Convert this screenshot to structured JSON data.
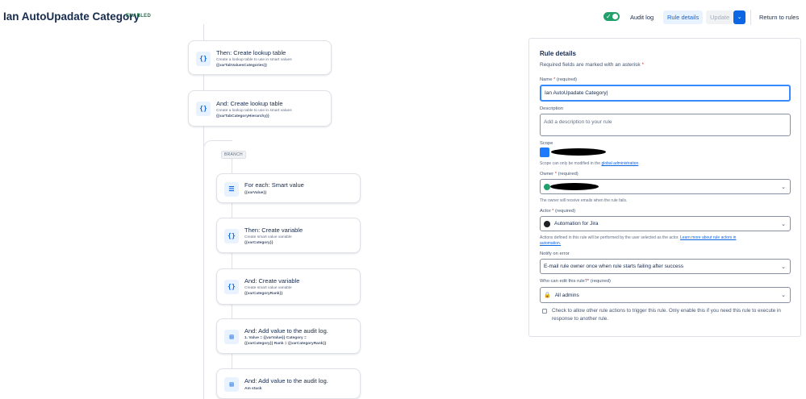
{
  "header": {
    "title": "Ian AutoUpadate Category",
    "status_badge": "ENABLED",
    "audit_log_label": "Audit log",
    "rule_details_label": "Rule details",
    "update_label": "Update",
    "return_label": "Return to rules",
    "toggle_on": true
  },
  "flow": {
    "branch_label": "BRANCH",
    "components": [
      {
        "title": "Then: Create lookup table",
        "subtitle": "Create a lookup table to use in smart values",
        "value": "{{varTabValuesCategories}}",
        "icon": "code-braces-icon"
      },
      {
        "title": "And: Create lookup table",
        "subtitle": "Create a lookup table to use in smart values",
        "value": "{{varTabCategoryHierarchy}}",
        "icon": "code-braces-icon"
      },
      {
        "title": "For each: Smart value",
        "subtitle": "",
        "value": "{{varValue}}",
        "icon": "list-icon"
      },
      {
        "title": "Then: Create variable",
        "subtitle": "Create smart value variable",
        "value": "{{varCategory}}",
        "icon": "code-braces-icon"
      },
      {
        "title": "And: Create variable",
        "subtitle": "Create smart value variable",
        "value": "{{varCategoryRank}}",
        "icon": "code-braces-icon"
      },
      {
        "title": "And: Add value to the audit log.",
        "subtitle": "",
        "value": "1. Value = {{varValue}} Category =",
        "value2": "{{varCategory}} Rank = {{varCategoryRank}}",
        "icon": "document-icon"
      },
      {
        "title": "And: Add value to the audit log.",
        "subtitle": "",
        "value": "Am stuck",
        "icon": "document-icon"
      }
    ]
  },
  "panel": {
    "title": "Rule details",
    "required_note": "Required fields are marked with an asterisk",
    "name_label": "Name",
    "name_required": "(required)",
    "name_value": "Ian AutoUpadate Category",
    "description_label": "Description",
    "description_placeholder": "Add a description to your rule",
    "scope_label": "Scope",
    "scope_helper": "Scope can only be modified in the",
    "scope_helper_link": "global administration",
    "owner_label": "Owner",
    "owner_required": "(required)",
    "owner_helper": "The owner will receive emails when the rule fails.",
    "actor_label": "Actor",
    "actor_required": "(required)",
    "actor_value": "Automation for Jira",
    "actor_helper": "Actions defined in this rule will be performed by the user selected as the actor.",
    "actor_helper_link": "Learn more about rule actors in",
    "actor_helper_link2": "automation.",
    "notify_label": "Notify on error",
    "notify_value": "E-mail rule owner once when rule starts failing after success",
    "edit_label": "Who can edit this rule?",
    "edit_required": "(required)",
    "edit_value": "All admins",
    "checkbox_text": "Check to allow other rule actions to trigger this rule. Only enable this if you need this rule to execute in response to another rule."
  },
  "colors": {
    "brand_blue": "#0c66e4",
    "toggle_green": "#22a06b",
    "badge_green": "#216e4e",
    "required_red": "#c9372c"
  }
}
